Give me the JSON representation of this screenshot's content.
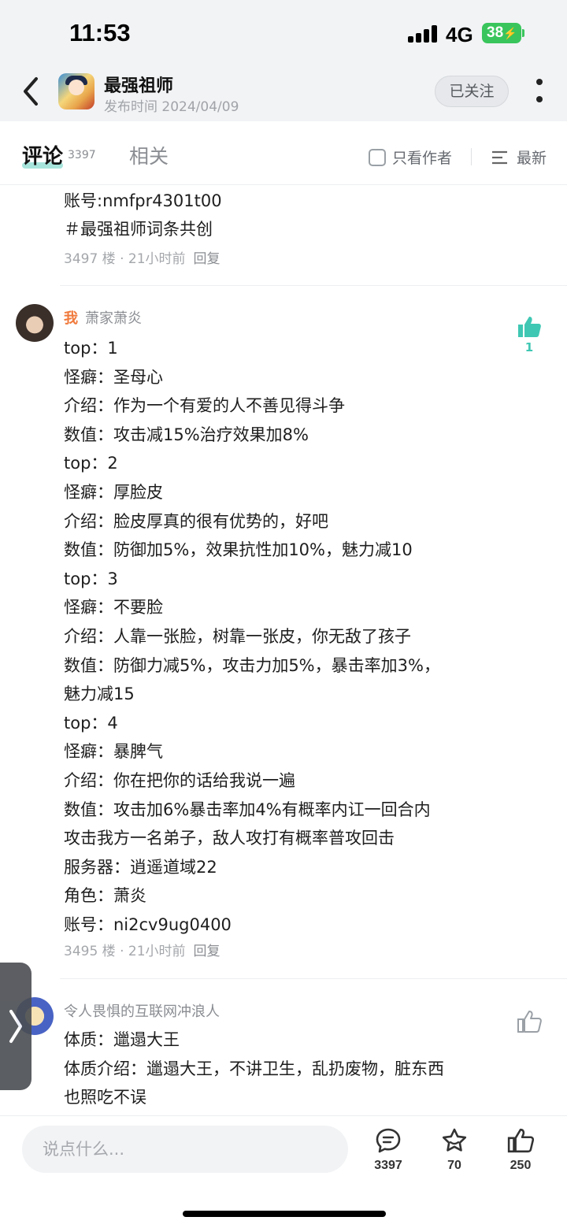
{
  "status_bar": {
    "time": "11:53",
    "network": "4G",
    "battery": "38"
  },
  "header": {
    "title": "最强祖师",
    "subtitle": "发布时间 2024/04/09",
    "follow_label": "已关注"
  },
  "tabs": {
    "comment_label": "评论",
    "comment_count": "3397",
    "related_label": "相关",
    "author_only_label": "只看作者",
    "sort_label": "最新"
  },
  "prev_comment": {
    "lines": [
      "账号:nmfpr4301t00",
      "＃最强祖师词条共创"
    ],
    "floor": "3497 楼 · 21小时前",
    "reply_label": "回复"
  },
  "main_comment": {
    "me_tag": "我",
    "username": "萧家萧炎",
    "like_count": "1",
    "lines": [
      "top：1",
      "怪癖：圣母心",
      "介绍：作为一个有爱的人不善见得斗争",
      "数值：攻击减15%治疗效果加8%",
      "top：2",
      "怪癖：厚脸皮",
      "介绍：脸皮厚真的很有优势的，好吧",
      "数值：防御加5%，效果抗性加10%，魅力减10",
      "top：3",
      "怪癖：不要脸",
      "介绍：人靠一张脸，树靠一张皮，你无敌了孩子",
      "数值：防御力减5%，攻击力加5%，暴击率加3%，",
      "魅力减15",
      "top：4",
      "怪癖：暴脾气",
      "介绍：你在把你的话给我说一遍",
      "数值：攻击加6%暴击率加4%有概率内讧一回合内",
      "攻击我方一名弟子，敌人攻打有概率普攻回击",
      "服务器：逍遥道域22",
      "角色：萧炎",
      "账号：ni2cv9ug0400"
    ],
    "floor": "3495 楼 · 21小时前",
    "reply_label": "回复"
  },
  "next_comment": {
    "username": "令人畏惧的互联网冲浪人",
    "lines": [
      "体质：邋遢大王",
      "体质介绍：邋遢大王，不讲卫生，乱扔废物，脏东西",
      "也照吃不误"
    ]
  },
  "bottom_bar": {
    "input_placeholder": "说点什么...",
    "comments_count": "3397",
    "favorites_count": "70",
    "likes_count": "250"
  },
  "icons": [
    "back-arrow-icon",
    "more-dots-icon",
    "checkbox-icon",
    "sort-list-icon",
    "thumb-up-icon",
    "comment-bubble-icon",
    "star-icon",
    "chevron-right-icon"
  ],
  "colors": {
    "accent": "#3fc7b3",
    "me_tag": "#f07a3c",
    "battery": "#39c55c"
  }
}
